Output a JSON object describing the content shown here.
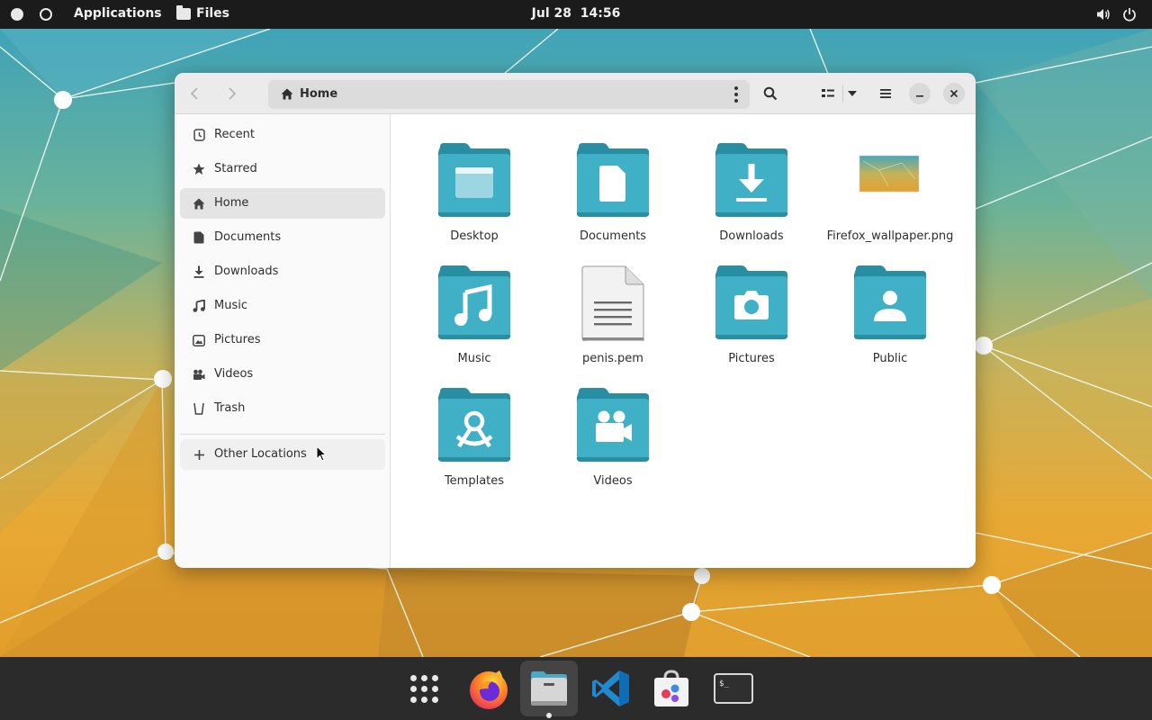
{
  "topbar": {
    "applications_label": "Applications",
    "app_name": "Files",
    "date": "Jul 28",
    "time": "14:56"
  },
  "window": {
    "path_label": "Home"
  },
  "sidebar": {
    "items": [
      {
        "label": "Recent",
        "icon": "clock-icon"
      },
      {
        "label": "Starred",
        "icon": "star-icon"
      },
      {
        "label": "Home",
        "icon": "home-icon",
        "active": true
      },
      {
        "label": "Documents",
        "icon": "document-icon"
      },
      {
        "label": "Downloads",
        "icon": "download-icon"
      },
      {
        "label": "Music",
        "icon": "music-note-icon"
      },
      {
        "label": "Pictures",
        "icon": "picture-icon"
      },
      {
        "label": "Videos",
        "icon": "video-camera-icon"
      },
      {
        "label": "Trash",
        "icon": "trash-icon"
      }
    ],
    "other_locations_label": "Other Locations"
  },
  "files": [
    {
      "name": "Desktop",
      "icon": "folder-desktop-icon"
    },
    {
      "name": "Documents",
      "icon": "folder-documents-icon"
    },
    {
      "name": "Downloads",
      "icon": "folder-downloads-icon"
    },
    {
      "name": "Firefox_wallpaper.png",
      "icon": "image-thumbnail-icon"
    },
    {
      "name": "Music",
      "icon": "folder-music-icon"
    },
    {
      "name": "penis.pem",
      "icon": "text-file-icon"
    },
    {
      "name": "Pictures",
      "icon": "folder-pictures-icon"
    },
    {
      "name": "Public",
      "icon": "folder-public-icon"
    },
    {
      "name": "Templates",
      "icon": "folder-templates-icon"
    },
    {
      "name": "Videos",
      "icon": "folder-videos-icon"
    }
  ],
  "dock": {
    "items": [
      "app-grid-icon",
      "firefox-icon",
      "files-icon",
      "vscode-icon",
      "software-store-icon",
      "terminal-icon"
    ],
    "terminal_prompt": "$_"
  },
  "colors": {
    "folder": "#3fb0c5",
    "folder_dark": "#2a8ea3",
    "topbar": "#1b1b1b",
    "dock": "#2b2b2b"
  }
}
